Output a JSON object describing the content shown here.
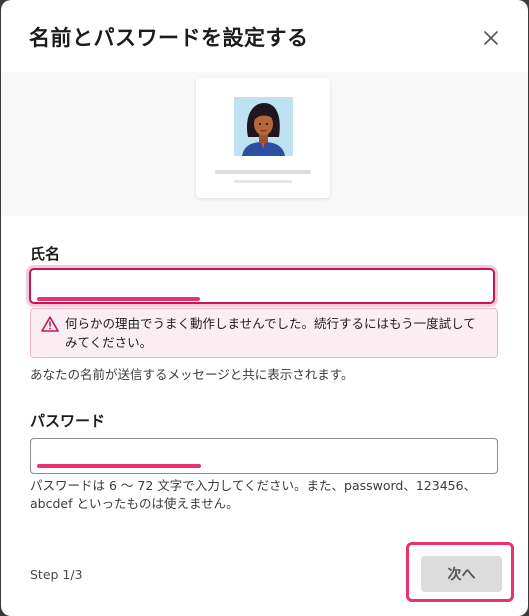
{
  "dialog": {
    "title": "名前とパスワードを設定する",
    "close_icon": "close-icon"
  },
  "illustration": {
    "avatar_icon": "person-avatar"
  },
  "name_field": {
    "label": "氏名",
    "value": "",
    "error_message": "何らかの理由でうまく動作しませんでした。続行するにはもう一度試してみてください。",
    "hint": "あなたの名前が送信するメッセージと共に表示されます。"
  },
  "password_field": {
    "label": "パスワード",
    "value": "",
    "hint": "パスワードは 6 ～ 72 文字で入力してください。また、password、123456、abcdef といったものは使えません。"
  },
  "footer": {
    "step": "Step 1/3",
    "next_label": "次へ"
  },
  "colors": {
    "error": "#c5145b",
    "annotation_highlight": "#e8336b",
    "error_background": "#fbeef2"
  }
}
